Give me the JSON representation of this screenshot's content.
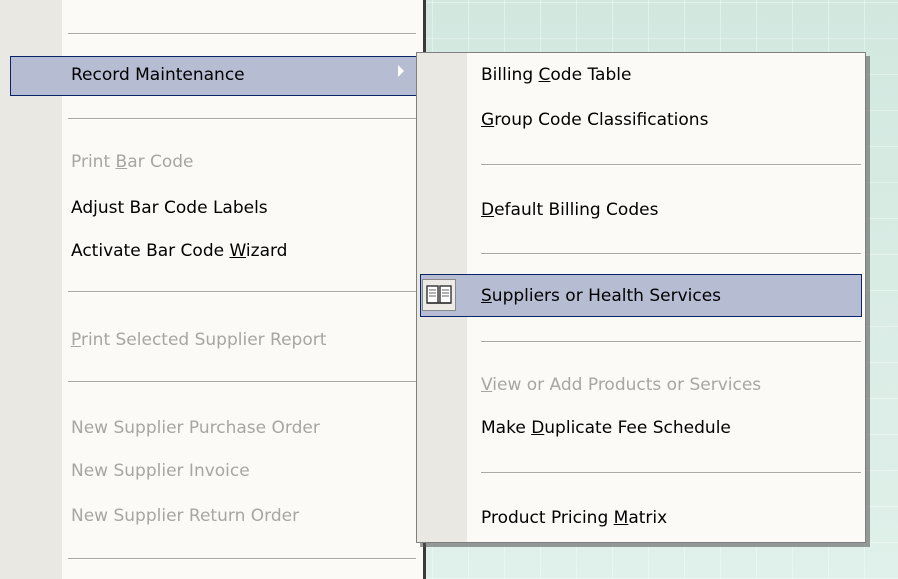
{
  "left_menu": {
    "items": [
      {
        "pre": "Record Maintenance",
        "u": "",
        "post": "",
        "state": "highlighted"
      },
      {
        "pre": "Print ",
        "u": "B",
        "post": "ar Code",
        "state": "disabled"
      },
      {
        "pre": "Adjust Bar Code Labels",
        "u": "",
        "post": "",
        "state": "enabled"
      },
      {
        "pre": "Activate Bar Code ",
        "u": "W",
        "post": "izard",
        "state": "enabled"
      },
      {
        "pre": "",
        "u": "P",
        "post": "rint Selected Supplier Report",
        "state": "disabled"
      },
      {
        "pre": "New Supplier Purchase Order",
        "u": "",
        "post": "",
        "state": "disabled"
      },
      {
        "pre": "New Supplier Invoice",
        "u": "",
        "post": "",
        "state": "disabled"
      },
      {
        "pre": "New Supplier Return Order",
        "u": "",
        "post": "",
        "state": "disabled"
      }
    ]
  },
  "submenu": {
    "items": [
      {
        "pre": "Billing ",
        "u": "C",
        "post": "ode Table",
        "state": "enabled"
      },
      {
        "pre": "",
        "u": "G",
        "post": "roup Code Classifications",
        "state": "enabled"
      },
      {
        "pre": "",
        "u": "D",
        "post": "efault Billing Codes",
        "state": "enabled"
      },
      {
        "pre": "",
        "u": "S",
        "post": "uppliers or Health Services",
        "state": "highlighted",
        "icon": "book-icon"
      },
      {
        "pre": "",
        "u": "V",
        "post": "iew or Add Products or Services",
        "state": "disabled"
      },
      {
        "pre": "Make ",
        "u": "D",
        "post": "uplicate Fee Schedule",
        "state": "enabled"
      },
      {
        "pre": "Product Pricing ",
        "u": "M",
        "post": "atrix",
        "state": "enabled"
      }
    ]
  },
  "colors": {
    "highlight_fill": "#b6bdd2",
    "highlight_border": "#0a246a",
    "menu_bg": "#fbfaf6",
    "gutter": "#e9e8e2",
    "disabled_text": "#a7a6a1"
  }
}
